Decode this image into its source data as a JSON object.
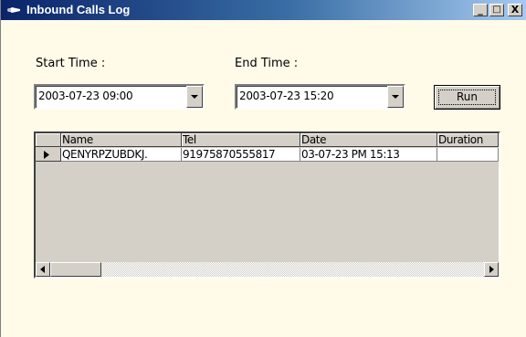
{
  "window": {
    "title": "Inbound Calls Log",
    "caption_buttons": {
      "minimize": "_",
      "maximize": "□",
      "close": "X"
    }
  },
  "filters": {
    "start_label": "Start Time :",
    "start_value": "2003-07-23 09:00",
    "end_label": "End Time :",
    "end_value": "2003-07-23 15:20",
    "run_label": "Run"
  },
  "grid": {
    "columns": [
      "Name",
      "Tel",
      "Date",
      "Duration"
    ],
    "rows": [
      {
        "name": "QENYRPZUBDKJ.",
        "tel": "91975870555817",
        "date": "03-07-23 PM 15:13",
        "duration": ""
      }
    ]
  },
  "icons": {
    "window": "phone-icon",
    "dropdown": "chevron-down-icon",
    "row_selector": "triangle-right-icon",
    "scroll_left": "arrow-left-icon",
    "scroll_right": "arrow-right-icon"
  }
}
